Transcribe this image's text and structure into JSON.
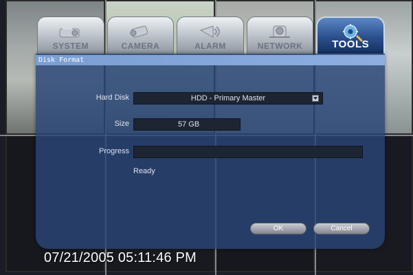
{
  "tabs": [
    {
      "label": "SYSTEM",
      "icon": "projector-icon",
      "active": false
    },
    {
      "label": "CAMERA",
      "icon": "camera-icon",
      "active": false
    },
    {
      "label": "ALARM",
      "icon": "siren-icon",
      "active": false
    },
    {
      "label": "NETWORK",
      "icon": "network-device-icon",
      "active": false
    },
    {
      "label": "TOOLS",
      "icon": "tools-gear-icon",
      "active": true
    }
  ],
  "dialog": {
    "title": "Disk Format"
  },
  "form": {
    "hard_disk_label": "Hard Disk",
    "hard_disk_value": "HDD - Primary Master",
    "size_label": "Size",
    "size_value": "57 GB",
    "progress_label": "Progress",
    "progress_value": 0,
    "status_text": "Ready"
  },
  "buttons": {
    "ok_label": "OK",
    "cancel_label": "Cancel"
  },
  "overlay": {
    "timestamp": "07/21/2005 05:11:46 PM"
  },
  "colors": {
    "active_tab": "#2b4f8d",
    "panel": "#28467a",
    "title_bar": "#8eaee0"
  }
}
